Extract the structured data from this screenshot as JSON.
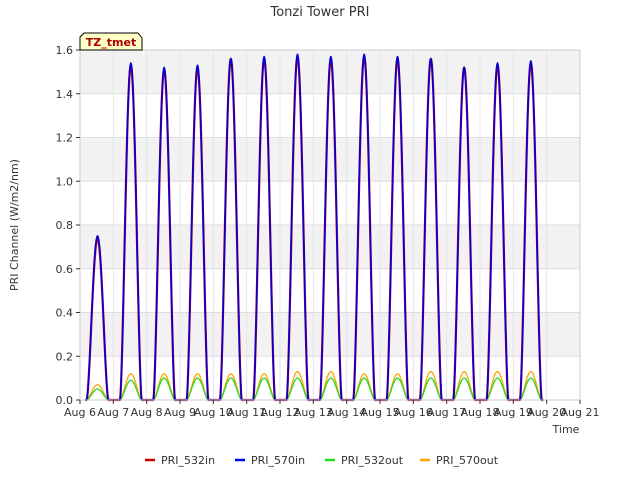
{
  "chart_data": {
    "type": "line",
    "title": "Tonzi Tower PRI",
    "xlabel": "Time",
    "ylabel": "PRI Channel (W/m2/nm)",
    "annotation": "TZ_tmet",
    "xlim": [
      6,
      21
    ],
    "ylim": [
      0,
      1.6
    ],
    "x_ticks": [
      6,
      7,
      8,
      9,
      10,
      11,
      12,
      13,
      14,
      15,
      16,
      17,
      18,
      19,
      20,
      21
    ],
    "x_tick_labels": [
      "Aug 6",
      "Aug 7",
      "Aug 8",
      "Aug 9",
      "Aug 10",
      "Aug 11",
      "Aug 12",
      "Aug 13",
      "Aug 14",
      "Aug 15",
      "Aug 16",
      "Aug 17",
      "Aug 18",
      "Aug 19",
      "Aug 20",
      "Aug 21"
    ],
    "y_ticks": [
      0.0,
      0.2,
      0.4,
      0.6,
      0.8,
      1.0,
      1.2,
      1.4,
      1.6
    ],
    "y_tick_labels": [
      "0.0",
      "0.2",
      "0.4",
      "0.6",
      "0.8",
      "1.0",
      "1.2",
      "1.4",
      "1.6"
    ],
    "grid": true,
    "legend_position": "bottom",
    "day_start": 6,
    "day_peaks": {
      "PRI_532in": [
        0.74,
        1.53,
        1.51,
        1.52,
        1.56,
        1.56,
        1.57,
        1.56,
        1.57,
        1.56,
        1.56,
        1.52,
        1.53,
        1.54
      ],
      "PRI_570in": [
        0.75,
        1.54,
        1.52,
        1.53,
        1.56,
        1.57,
        1.58,
        1.57,
        1.58,
        1.57,
        1.56,
        1.52,
        1.54,
        1.55
      ],
      "PRI_532out": [
        0.05,
        0.09,
        0.1,
        0.1,
        0.1,
        0.1,
        0.1,
        0.1,
        0.1,
        0.1,
        0.1,
        0.1,
        0.1,
        0.1
      ],
      "PRI_570out": [
        0.07,
        0.12,
        0.12,
        0.12,
        0.12,
        0.12,
        0.13,
        0.13,
        0.12,
        0.12,
        0.13,
        0.13,
        0.13,
        0.13
      ]
    },
    "series": [
      {
        "name": "PRI_532in",
        "color": "#cc0000"
      },
      {
        "name": "PRI_570in",
        "color": "#0000dd"
      },
      {
        "name": "PRI_532out",
        "color": "#22dd22"
      },
      {
        "name": "PRI_570out",
        "color": "#ffa500"
      }
    ]
  }
}
